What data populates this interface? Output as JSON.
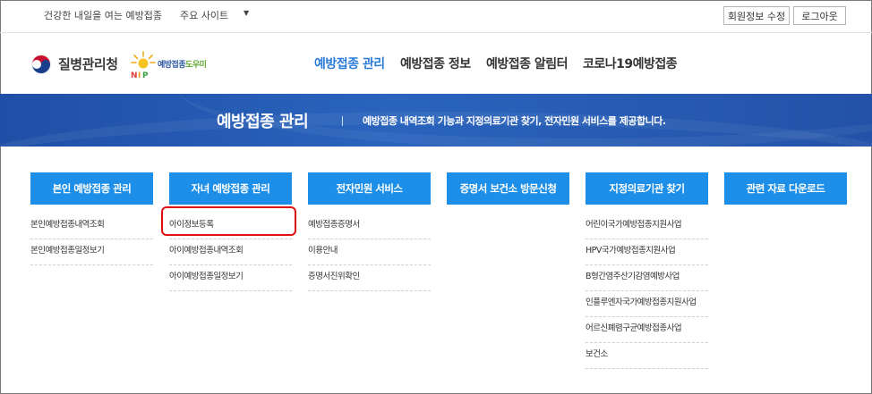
{
  "topbar": {
    "slogan": "건강한 내일을 여는 예방접종",
    "site_select": "주요 사이트",
    "edit_profile": "회원정보 수정",
    "logout": "로그아웃"
  },
  "header": {
    "org_name": "질병관리청",
    "helper_prefix": "예방접종",
    "helper_suffix": "도우미",
    "nav": [
      "예방접종 관리",
      "예방접종 정보",
      "예방접종 알림터",
      "코로나19예방접종"
    ]
  },
  "banner": {
    "title": "예방접종 관리",
    "description": "예방접종 내역조회 기능과 지정의료기관 찾기, 전자민원 서비스를 제공합니다."
  },
  "menu": [
    {
      "title": "본인 예방접종 관리",
      "items": [
        "본인예방접종내역조회",
        "본인예방접종일정보기"
      ]
    },
    {
      "title": "자녀 예방접종 관리",
      "items": [
        "아이정보등록",
        "아이예방접종내역조회",
        "아이예방접종일정보기"
      ]
    },
    {
      "title": "전자민원 서비스",
      "items": [
        "예방접종증명서",
        "이용안내",
        "증명서진위확인"
      ]
    },
    {
      "title": "증명서 보건소 방문신청",
      "items": []
    },
    {
      "title": "지정의료기관 찾기",
      "items": [
        "어린이국가예방접종지원사업",
        "HPV국가예방접종지원사업",
        "B형간염주산기감염예방사업",
        "인플루엔자국가예방접종지원사업",
        "어르신폐렴구균예방접종사업",
        "보건소"
      ]
    },
    {
      "title": "관련 자료 다운로드",
      "items": []
    }
  ],
  "colors": {
    "menu_header": "#1e8fe8",
    "banner": "#2a5cb5",
    "nav_active": "#2a7ad8",
    "highlight": "#e01010"
  }
}
